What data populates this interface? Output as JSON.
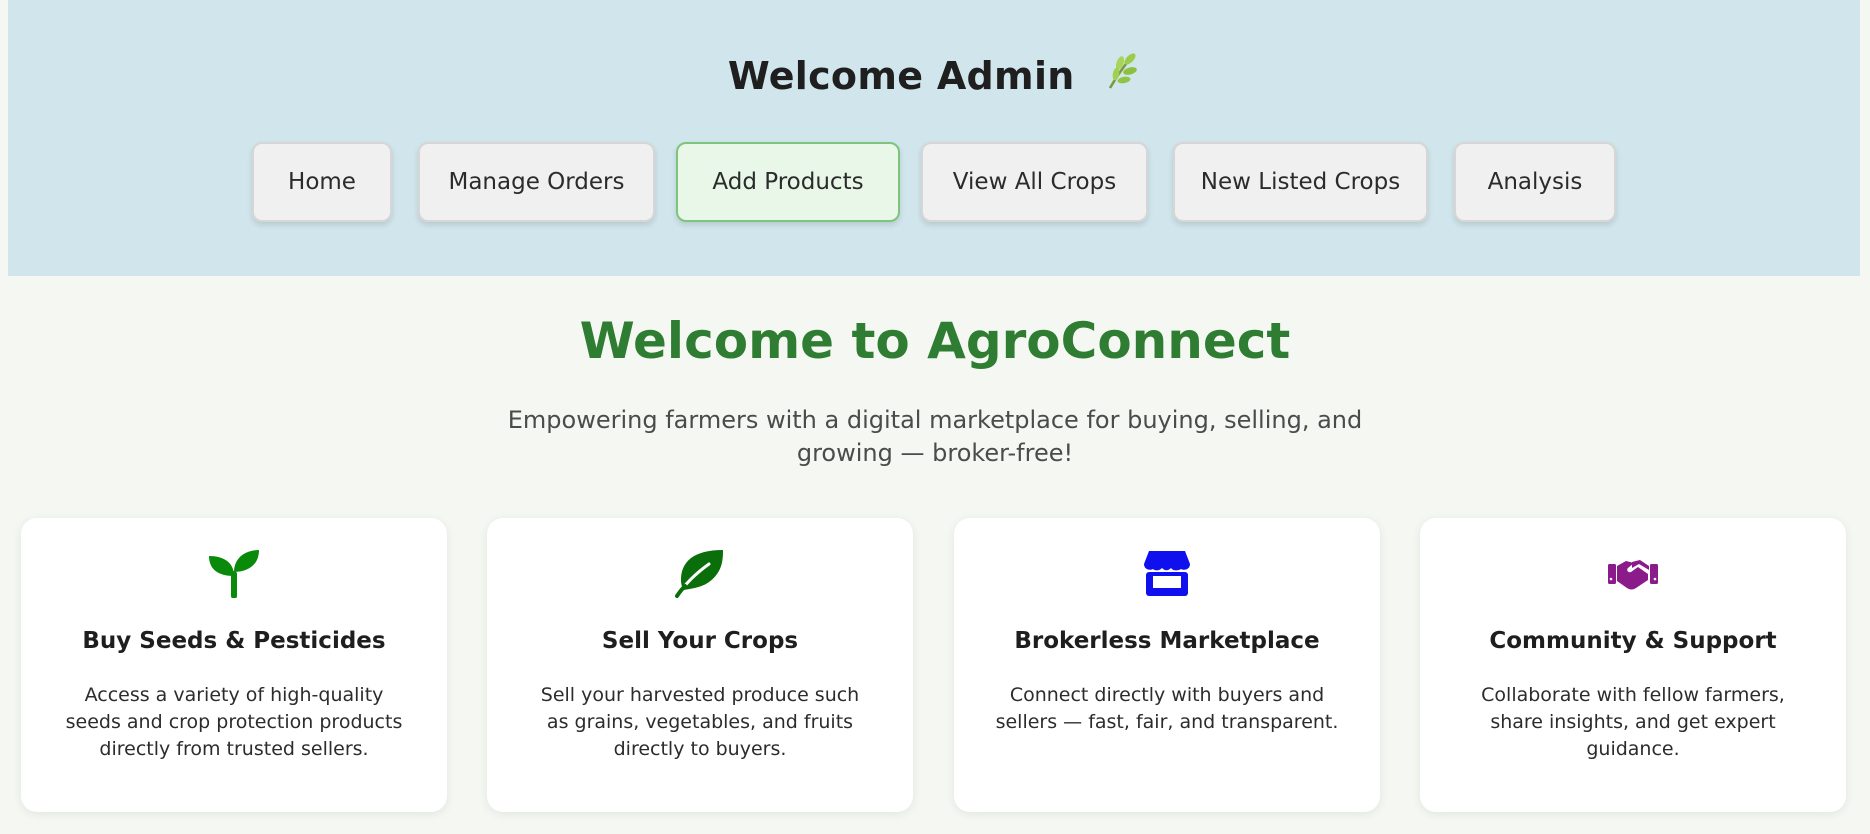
{
  "header": {
    "title": "Welcome Admin",
    "nav": [
      {
        "label": "Home"
      },
      {
        "label": "Manage Orders"
      },
      {
        "label": "Add Products",
        "active": true
      },
      {
        "label": "View All Crops"
      },
      {
        "label": "New Listed Crops"
      },
      {
        "label": "Analysis"
      }
    ]
  },
  "hero": {
    "title": "Welcome to AgroConnect",
    "subtitle": "Empowering farmers with a digital marketplace for buying, selling, and growing — broker-free!"
  },
  "features": [
    {
      "icon": "seedling-icon",
      "color": "#0a8a0a",
      "title": "Buy Seeds & Pesticides",
      "desc": "Access a variety of high-quality seeds and crop protection products directly from trusted sellers."
    },
    {
      "icon": "leaf-icon",
      "color": "#0a6e0a",
      "title": "Sell Your Crops",
      "desc": "Sell your harvested produce such as grains, vegetables, and fruits directly to buyers."
    },
    {
      "icon": "store-icon",
      "color": "#1010ee",
      "title": "Brokerless Marketplace",
      "desc": "Connect directly with buyers and sellers — fast, fair, and transparent."
    },
    {
      "icon": "handshake-icon",
      "color": "#8b1a8b",
      "title": "Community & Support",
      "desc": "Collaborate with fellow farmers, share insights, and get expert guidance."
    }
  ],
  "colors": {
    "header_bg": "#d0e6ec",
    "page_bg": "#f5f8f2",
    "hero_title": "#2e7d32",
    "active_button_bg": "#e8f7e8"
  }
}
